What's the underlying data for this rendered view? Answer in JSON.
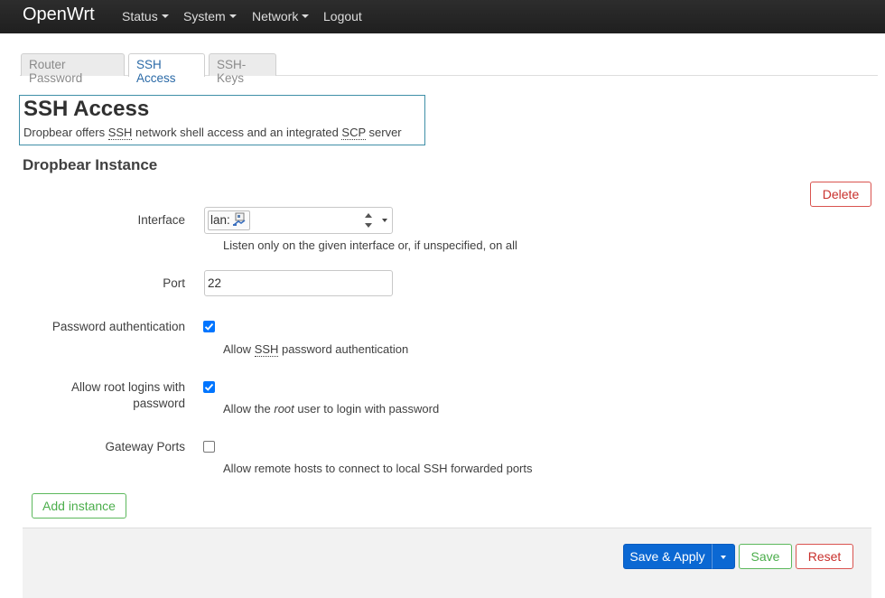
{
  "nav": {
    "brand": "OpenWrt",
    "menu": [
      {
        "label": "Status",
        "has_dropdown": true
      },
      {
        "label": "System",
        "has_dropdown": true
      },
      {
        "label": "Network",
        "has_dropdown": true
      },
      {
        "label": "Logout",
        "has_dropdown": false
      }
    ]
  },
  "tabs": [
    {
      "label": "Router Password",
      "active": false
    },
    {
      "label": "SSH Access",
      "active": true
    },
    {
      "label": "SSH-Keys",
      "active": false
    }
  ],
  "page": {
    "title": "SSH Access",
    "desc_prefix": "Dropbear offers ",
    "desc_abbr1": "SSH",
    "desc_middle": " network shell access and an integrated ",
    "desc_abbr2": "SCP",
    "desc_suffix": " server"
  },
  "section": {
    "title": "Dropbear Instance",
    "delete_label": "Delete"
  },
  "fields": {
    "interface": {
      "label": "Interface",
      "value": "lan:",
      "icon": "network-interface-icon",
      "hint": "Listen only on the given interface or, if unspecified, on all"
    },
    "port": {
      "label": "Port",
      "value": "22"
    },
    "password_auth": {
      "label": "Password authentication",
      "checked": true,
      "hint_prefix": "Allow ",
      "hint_abbr": "SSH",
      "hint_suffix": " password authentication"
    },
    "root_login": {
      "label_line1": "Allow root logins with",
      "label_line2": "password",
      "checked": true,
      "hint_prefix": "Allow the ",
      "hint_em": "root",
      "hint_suffix": " user to login with password"
    },
    "gateway_ports": {
      "label": "Gateway Ports",
      "checked": false,
      "hint": "Allow remote hosts to connect to local SSH forwarded ports"
    }
  },
  "add_instance_label": "Add instance",
  "footer": {
    "save_apply_label": "Save & Apply",
    "save_label": "Save",
    "reset_label": "Reset"
  },
  "colors": {
    "accent_blue": "#0b68d3",
    "success_green": "#5cb85c",
    "danger_red": "#d9534f",
    "checkbox_blue": "#0075ff"
  }
}
